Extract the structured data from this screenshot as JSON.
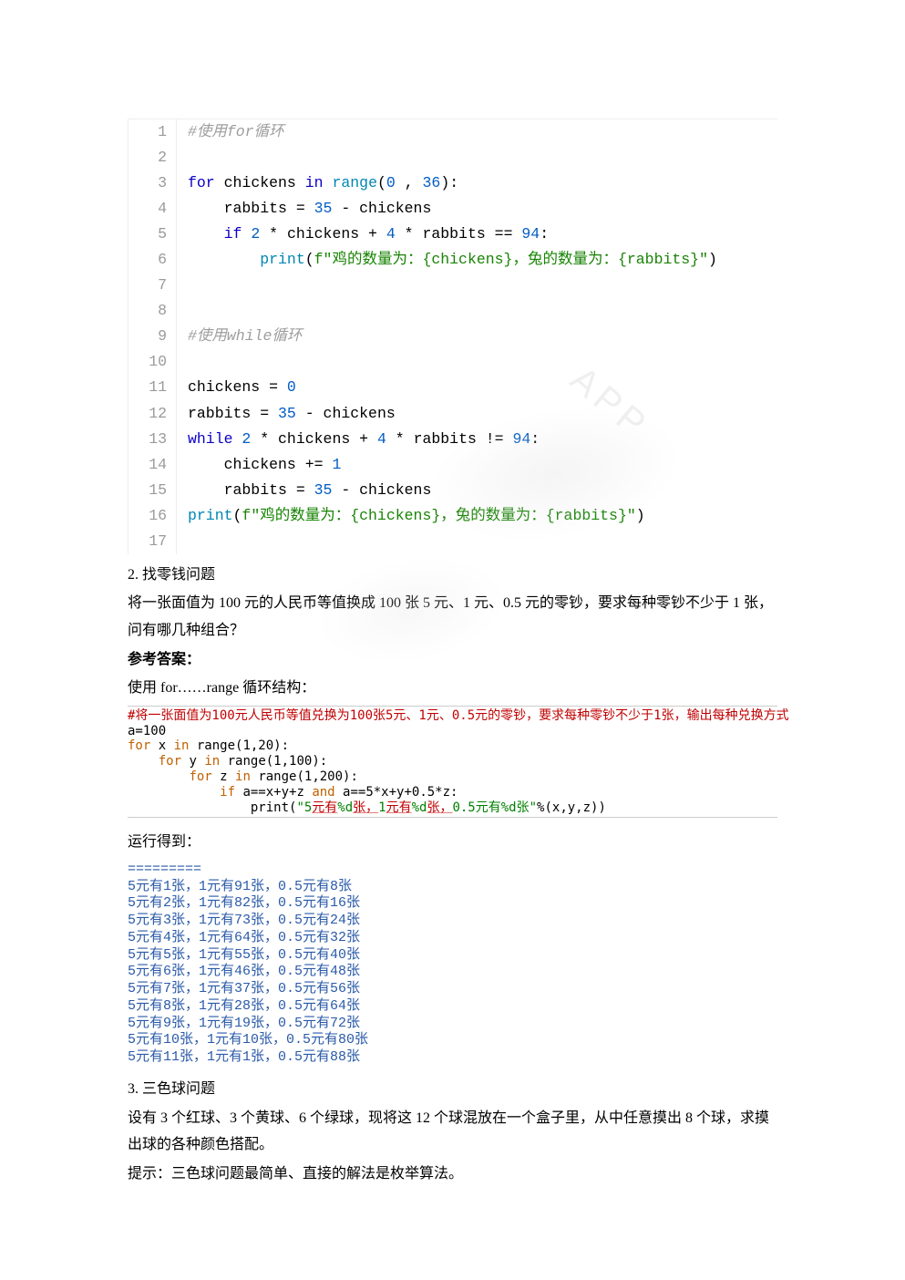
{
  "code1": {
    "lines": [
      {
        "n": "1",
        "segs": [
          {
            "cls": "c-comment",
            "t": "#使用for循环"
          }
        ]
      },
      {
        "n": "2",
        "segs": []
      },
      {
        "n": "3",
        "segs": [
          {
            "cls": "c-kw",
            "t": "for"
          },
          {
            "cls": "",
            "t": " chickens "
          },
          {
            "cls": "c-kw",
            "t": "in"
          },
          {
            "cls": "",
            "t": " "
          },
          {
            "cls": "c-builtin",
            "t": "range"
          },
          {
            "cls": "",
            "t": "("
          },
          {
            "cls": "c-num",
            "t": "0"
          },
          {
            "cls": "",
            "t": " , "
          },
          {
            "cls": "c-num",
            "t": "36"
          },
          {
            "cls": "",
            "t": "):"
          }
        ]
      },
      {
        "n": "4",
        "segs": [
          {
            "cls": "",
            "t": "    rabbits = "
          },
          {
            "cls": "c-num",
            "t": "35"
          },
          {
            "cls": "",
            "t": " - chickens"
          }
        ]
      },
      {
        "n": "5",
        "segs": [
          {
            "cls": "",
            "t": "    "
          },
          {
            "cls": "c-kw",
            "t": "if"
          },
          {
            "cls": "",
            "t": " "
          },
          {
            "cls": "c-num",
            "t": "2"
          },
          {
            "cls": "",
            "t": " * chickens + "
          },
          {
            "cls": "c-num",
            "t": "4"
          },
          {
            "cls": "",
            "t": " * rabbits == "
          },
          {
            "cls": "c-num",
            "t": "94"
          },
          {
            "cls": "",
            "t": ":"
          }
        ]
      },
      {
        "n": "6",
        "segs": [
          {
            "cls": "",
            "t": "        "
          },
          {
            "cls": "c-builtin",
            "t": "print"
          },
          {
            "cls": "",
            "t": "("
          },
          {
            "cls": "c-str",
            "t": "f\"鸡的数量为：{chickens}，兔的数量为：{rabbits}\""
          },
          {
            "cls": "",
            "t": ")"
          }
        ]
      },
      {
        "n": "7",
        "segs": []
      },
      {
        "n": "8",
        "segs": []
      },
      {
        "n": "9",
        "segs": [
          {
            "cls": "c-comment",
            "t": "#使用while循环"
          }
        ]
      },
      {
        "n": "10",
        "segs": []
      },
      {
        "n": "11",
        "segs": [
          {
            "cls": "",
            "t": "chickens = "
          },
          {
            "cls": "c-num",
            "t": "0"
          }
        ]
      },
      {
        "n": "12",
        "segs": [
          {
            "cls": "",
            "t": "rabbits = "
          },
          {
            "cls": "c-num",
            "t": "35"
          },
          {
            "cls": "",
            "t": " - chickens"
          }
        ]
      },
      {
        "n": "13",
        "segs": [
          {
            "cls": "c-kw",
            "t": "while"
          },
          {
            "cls": "",
            "t": " "
          },
          {
            "cls": "c-num",
            "t": "2"
          },
          {
            "cls": "",
            "t": " * chickens + "
          },
          {
            "cls": "c-num",
            "t": "4"
          },
          {
            "cls": "",
            "t": " * rabbits != "
          },
          {
            "cls": "c-num",
            "t": "94"
          },
          {
            "cls": "",
            "t": ":"
          }
        ]
      },
      {
        "n": "14",
        "segs": [
          {
            "cls": "",
            "t": "    chickens += "
          },
          {
            "cls": "c-num",
            "t": "1"
          }
        ]
      },
      {
        "n": "15",
        "segs": [
          {
            "cls": "",
            "t": "    rabbits = "
          },
          {
            "cls": "c-num",
            "t": "35"
          },
          {
            "cls": "",
            "t": " - chickens"
          }
        ]
      },
      {
        "n": "16",
        "segs": [
          {
            "cls": "c-builtin",
            "t": "print"
          },
          {
            "cls": "",
            "t": "("
          },
          {
            "cls": "c-str",
            "t": "f\"鸡的数量为：{chickens}，兔的数量为：{rabbits}\""
          },
          {
            "cls": "",
            "t": ")"
          }
        ]
      },
      {
        "n": "17",
        "segs": []
      }
    ]
  },
  "section2": {
    "heading": "2. 找零钱问题",
    "p1": "将一张面值为 100 元的人民币等值换成 100 张 5 元、1 元、0.5 元的零钞，要求每种零钞不少于 1 张，问有哪几种组合？",
    "answer_label": "参考答案：",
    "method": "使用 for……range 循环结构："
  },
  "code2": {
    "lines": [
      {
        "segs": [
          {
            "cls": "p2-comment",
            "t": "#将一张面值为100元人民币等值兑换为100张5元、1元、0.5元的零钞，要求每种零钞不少于1张，输出每种兑换方式"
          }
        ]
      },
      {
        "segs": [
          {
            "cls": "",
            "t": "a=100"
          }
        ]
      },
      {
        "segs": [
          {
            "cls": "p2-kw",
            "t": "for"
          },
          {
            "cls": "",
            "t": " x "
          },
          {
            "cls": "p2-kw",
            "t": "in"
          },
          {
            "cls": "",
            "t": " range(1,20):"
          }
        ]
      },
      {
        "segs": [
          {
            "cls": "",
            "t": "    "
          },
          {
            "cls": "p2-kw",
            "t": "for"
          },
          {
            "cls": "",
            "t": " y "
          },
          {
            "cls": "p2-kw",
            "t": "in"
          },
          {
            "cls": "",
            "t": " range(1,100):"
          }
        ]
      },
      {
        "segs": [
          {
            "cls": "",
            "t": "        "
          },
          {
            "cls": "p2-kw",
            "t": "for"
          },
          {
            "cls": "",
            "t": " z "
          },
          {
            "cls": "p2-kw",
            "t": "in"
          },
          {
            "cls": "",
            "t": " range(1,200):"
          }
        ]
      },
      {
        "segs": [
          {
            "cls": "",
            "t": "            "
          },
          {
            "cls": "p2-kw",
            "t": "if"
          },
          {
            "cls": "",
            "t": " a==x+y+z "
          },
          {
            "cls": "p2-kw",
            "t": "and"
          },
          {
            "cls": "",
            "t": " a==5*x+y+0.5*z:"
          }
        ]
      },
      {
        "segs": [
          {
            "cls": "",
            "t": "                print("
          },
          {
            "cls": "p2-str",
            "t": "\"5"
          },
          {
            "cls": "p2-strred",
            "t": "元有"
          },
          {
            "cls": "p2-str",
            "t": "%d"
          },
          {
            "cls": "p2-strred",
            "t": "张，"
          },
          {
            "cls": "p2-str",
            "t": "1"
          },
          {
            "cls": "p2-strred",
            "t": "元有"
          },
          {
            "cls": "p2-str",
            "t": "%d"
          },
          {
            "cls": "p2-strred",
            "t": "张，"
          },
          {
            "cls": "p2-str",
            "t": "0.5元有%d张\""
          },
          {
            "cls": "",
            "t": "%(x,y,z))"
          }
        ]
      }
    ]
  },
  "output_label": "运行得到：",
  "output": {
    "sep": "=========",
    "rows": [
      "5元有1张，1元有91张，0.5元有8张",
      "5元有2张，1元有82张，0.5元有16张",
      "5元有3张，1元有73张，0.5元有24张",
      "5元有4张，1元有64张，0.5元有32张",
      "5元有5张，1元有55张，0.5元有40张",
      "5元有6张，1元有46张，0.5元有48张",
      "5元有7张，1元有37张，0.5元有56张",
      "5元有8张，1元有28张，0.5元有64张",
      "5元有9张，1元有19张，0.5元有72张",
      "5元有10张，1元有10张，0.5元有80张",
      "5元有11张，1元有1张，0.5元有88张"
    ]
  },
  "section3": {
    "heading": "3. 三色球问题",
    "p1": "设有 3 个红球、3 个黄球、6 个绿球，现将这 12 个球混放在一个盒子里，从中任意摸出 8 个球，求摸出球的各种颜色搭配。",
    "p2": "提示：三色球问题最简单、直接的解法是枚举算法。"
  },
  "wm": "APP"
}
